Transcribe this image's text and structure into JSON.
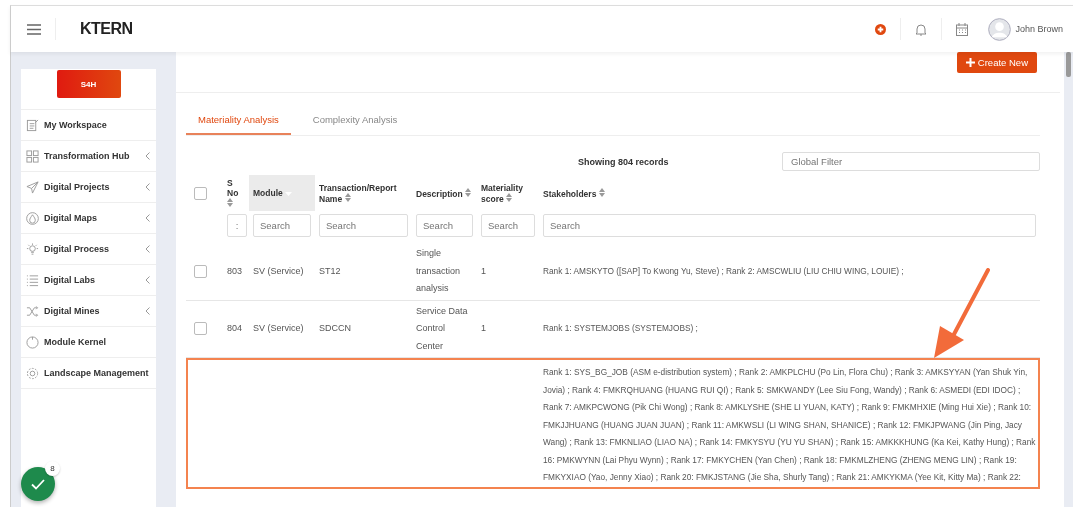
{
  "header": {
    "brand": "KTERN",
    "user": "John Brown"
  },
  "sidebar": {
    "badge": "S4H",
    "items": [
      {
        "label": "My Workspace",
        "expandable": false
      },
      {
        "label": "Transformation Hub",
        "expandable": true
      },
      {
        "label": "Digital Projects",
        "expandable": true
      },
      {
        "label": "Digital Maps",
        "expandable": true
      },
      {
        "label": "Digital Process",
        "expandable": true
      },
      {
        "label": "Digital Labs",
        "expandable": true
      },
      {
        "label": "Digital Mines",
        "expandable": true
      },
      {
        "label": "Module Kernel",
        "expandable": false
      },
      {
        "label": "Landscape Management",
        "expandable": false
      }
    ]
  },
  "status_button": {
    "count": "8"
  },
  "create_button": "Create New",
  "tabs": [
    {
      "label": "Materiality Analysis",
      "selected": true
    },
    {
      "label": "Complexity Analysis",
      "selected": false
    }
  ],
  "table": {
    "select_all_checked": false,
    "record_count": "Showing 804 records",
    "global_filter": {
      "placeholder": "Global Filter"
    },
    "columns": [
      {
        "label": "S No",
        "sorted": false,
        "filter_placeholder": ":"
      },
      {
        "label": "Module",
        "sorted": true,
        "filter_placeholder": "Search"
      },
      {
        "label": "Transaction/Report Name",
        "sorted": false,
        "filter_placeholder": "Search"
      },
      {
        "label": "Description",
        "sorted": false,
        "filter_placeholder": "Search"
      },
      {
        "label": "Materiality score",
        "sorted": false,
        "filter_placeholder": "Search"
      },
      {
        "label": "Stakeholders",
        "sorted": false,
        "filter_placeholder": "Search"
      }
    ],
    "rows": [
      {
        "checked": false,
        "highlighted": false,
        "cells": [
          "803",
          "SV (Service)",
          "ST12",
          "Single transaction analysis",
          "1",
          "Rank 1: AMSKYTO ([SAP] To Kwong Yu, Steve) ; Rank 2: AMSCWLIU (LIU CHIU WING, LOUIE) ;"
        ]
      },
      {
        "checked": false,
        "highlighted": false,
        "cells": [
          "804",
          "SV (Service)",
          "SDCCN",
          "Service Data Control Center",
          "1",
          "Rank 1: SYSTEMJOBS (SYSTEMJOBS) ;"
        ]
      },
      {
        "highlighted": true,
        "cells": [
          "",
          "",
          "",
          "",
          "",
          "Rank 1: SYS_BG_JOB (ASM e-distribution system) ; Rank 2: AMKPLCHU (Po Lin, Flora Chu) ; Rank 3: AMKSYYAN (Yan Shuk Yin, Jovia) ; Rank 4: FMKRQHUANG (HUANG RUI QI) ; Rank 5: SMKWANDY (Lee Siu Fong, Wandy) ; Rank 6: ASMEDI (EDI IDOC) ; Rank 7: AMKPCWONG (Pik Chi Wong) ; Rank 8: AMKLYSHE (SHE LI YUAN, KATY) ; Rank 9: FMKMHXIE (Ming Hui Xie) ; Rank 10: FMKJJHUANG (HUANG JUAN JUAN) ; Rank 11: AMKWSLI (LI WING SHAN, SHANICE) ; Rank 12: FMKJPWANG (Jin Ping, Jacy Wang) ; Rank 13: FMKNLIAO (LIAO NA) ; Rank 14: FMKYSYU (YU YU SHAN) ; Rank 15: AMKKKHUNG (Ka Kei, Kathy Hung) ; Rank 16: PMKWYNN (Lai Phyu Wynn) ; Rank 17: FMKYCHEN (Yan Chen) ; Rank 18: FMKMLZHENG (ZHENG MENG LIN) ; Rank 19: FMKYXIAO (Yao, Jenny Xiao) ; Rank 20: FMKJSTANG (Jie Sha, Shurly Tang) ; Rank 21: AMKYKMA (Yee Kit, Kitty Ma) ; Rank 22:"
        ]
      }
    ]
  }
}
